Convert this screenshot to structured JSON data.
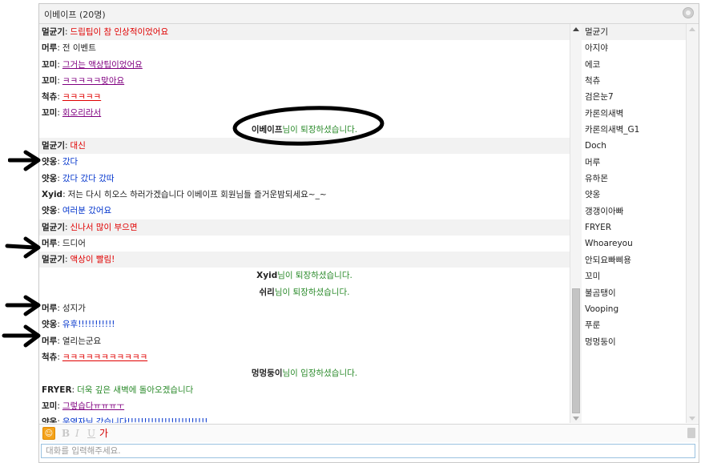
{
  "title": "이베이프 (20명)",
  "colors": {
    "purple": "#800080",
    "red": "#e00000",
    "blue": "#0033cc",
    "green": "#2a8a2a",
    "dark": "#222222"
  },
  "messages": [
    {
      "nick": "멀균기",
      "text": "드립팁이 참 인상적이었어요",
      "color": "red",
      "shade": true
    },
    {
      "nick": "머루",
      "text": "전 이벤트",
      "color": "dark",
      "shade": false
    },
    {
      "nick": "꼬미",
      "text": "그거는 액상팁이었어요",
      "color": "purple",
      "underline": true,
      "shade": false
    },
    {
      "nick": "꼬미",
      "text": "ㅋㅋㅋㅋㅋ맞아요",
      "color": "purple",
      "underline": true,
      "shade": false
    },
    {
      "nick": "척츄",
      "text": "ㅋㅋㅋㅋㅋ",
      "color": "red",
      "underline": true,
      "shade": false
    },
    {
      "nick": "꼬미",
      "text": "회오리라서",
      "color": "purple",
      "underline": true,
      "shade": false
    },
    {
      "sys": true,
      "nick": "이베이프",
      "text": "님이 퇴장하셨습니다.",
      "shade": false
    },
    {
      "nick": "멀균기",
      "text": "대신",
      "color": "red",
      "shade": true
    },
    {
      "nick": "얏옹",
      "text": "갔다",
      "color": "blue",
      "shade": false
    },
    {
      "nick": "얏옹",
      "text": "갔다 갔다 갔따",
      "color": "blue",
      "shade": false
    },
    {
      "nick": "Xyid",
      "text": "저는 다시 히오스 하러가겠습니다 이베이프 회원님들 즐거운밤되세요~_~",
      "color": "dark",
      "shade": false
    },
    {
      "nick": "얏옹",
      "text": "여러분 갔어요",
      "color": "blue",
      "shade": false
    },
    {
      "nick": "멀균기",
      "text": "신나서 많이 부으면",
      "color": "red",
      "shade": true
    },
    {
      "nick": "머루",
      "text": "드디어",
      "color": "dark",
      "shade": false
    },
    {
      "nick": "멀균기",
      "text": "액상이 빨림!",
      "color": "red",
      "shade": true
    },
    {
      "sys": true,
      "nick": "Xyid",
      "text": "님이 퇴장하셨습니다.",
      "shade": false
    },
    {
      "sys": true,
      "nick": "쉬리",
      "text": "님이 퇴장하셨습니다.",
      "shade": false
    },
    {
      "nick": "머루",
      "text": "성지가",
      "color": "dark",
      "shade": false
    },
    {
      "nick": "얏옹",
      "text": "유후!!!!!!!!!!!",
      "color": "blue",
      "shade": false
    },
    {
      "nick": "머루",
      "text": "열리는군요",
      "color": "dark",
      "shade": false
    },
    {
      "nick": "척츄",
      "text": "ㅋㅋㅋㅋㅋㅋㅋㅋㅋㅋㅋ",
      "color": "red",
      "underline": true,
      "shade": false
    },
    {
      "sys": true,
      "nick": "멍멍둥이",
      "text": "님이 입장하셨습니다.",
      "shade": false
    },
    {
      "nick": "FRYER",
      "text": "더욱 깊은 새벽에 돌아오겠습니다",
      "color": "green",
      "shade": false
    },
    {
      "nick": "꼬미",
      "text": "그렇습다ㅠㅠㅠㅜ",
      "color": "purple",
      "underline": true,
      "shade": false
    },
    {
      "nick": "얏옹",
      "text": "운영자님 갔습니다!!!!!!!!!!!!!!!!!!!!!!!!",
      "color": "blue",
      "shade": false
    }
  ],
  "users": [
    "멀균기",
    "아지야",
    "에코",
    "척츄",
    "검은눈7",
    "카론의새벽",
    "카론의새벽_G1",
    "Doch",
    "머루",
    "유하몬",
    "얏옹",
    "갱갱이아빠",
    "FRYER",
    "Whoareyou",
    "안되요빠삐용",
    "꼬미",
    "불곰탱이",
    "Vooping",
    "푸룬",
    "멍멍둥이"
  ],
  "toolbar": {
    "bold": "B",
    "italic": "I",
    "underline": "U",
    "color_label": "가"
  },
  "input": {
    "placeholder": "대화를 입력해주세요.",
    "value": ""
  }
}
